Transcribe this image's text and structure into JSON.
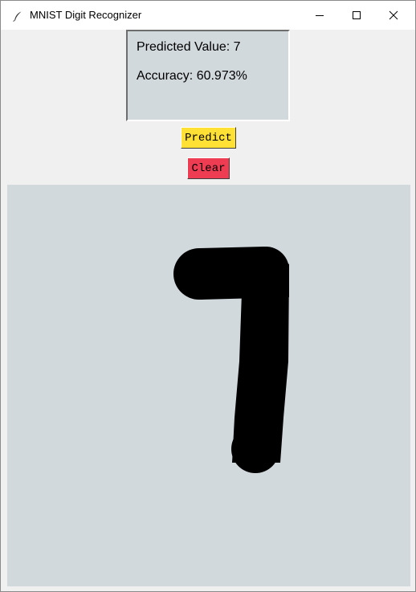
{
  "window": {
    "title": "MNIST Digit Recognizer",
    "icon": "feather-icon",
    "controls": {
      "minimize": "minimize-icon",
      "maximize": "maximize-icon",
      "close": "close-icon"
    }
  },
  "result": {
    "predicted_label": "Predicted Value: 7",
    "accuracy_label": "Accuracy: 60.973%"
  },
  "buttons": {
    "predict_label": "Predict",
    "clear_label": "Clear"
  },
  "colors": {
    "predict_button": "#ffe135",
    "clear_button": "#ee3c53",
    "canvas_background": "#d1d9dd",
    "stroke": "#000000"
  },
  "canvas": {
    "drawn_digit": "7"
  }
}
